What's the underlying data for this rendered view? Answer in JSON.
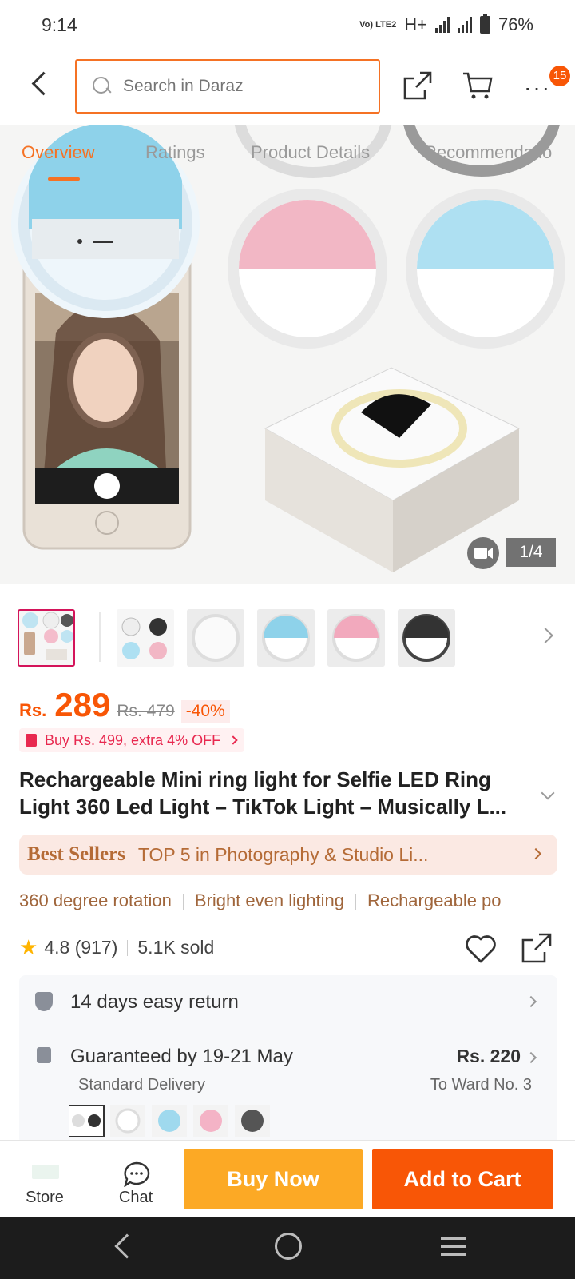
{
  "status_bar": {
    "time": "9:14",
    "network_label": "Vo) LTE2",
    "network_type": "H+",
    "battery": "76%"
  },
  "header": {
    "search_placeholder": "Search in Daraz",
    "cart_badge": "15"
  },
  "gallery_tabs": [
    "Overview",
    "Ratings",
    "Product Details",
    "Recommendatio"
  ],
  "active_tab": 0,
  "image_counter": "1/4",
  "thumbnail_count": 6,
  "price": {
    "currency": "Rs.",
    "current": "289",
    "original": "Rs. 479",
    "discount": "-40%"
  },
  "promo": {
    "text": "Buy Rs. 499, extra 4% OFF"
  },
  "product_title": "Rechargeable Mini ring light for Selfie LED Ring Light 360 Led Light – TikTok Light – Musically L...",
  "best_sellers": {
    "tag": "Best Sellers",
    "text": "TOP 5 in Photography & Studio Li..."
  },
  "features": [
    "360 degree rotation",
    "Bright even lighting",
    "Rechargeable po"
  ],
  "rating": {
    "score": "4.8",
    "count": "(917)",
    "sold": "5.1K sold"
  },
  "info": {
    "return_text": "14 days easy return",
    "delivery_text": "Guaranteed by 19-21 May",
    "delivery_sub": "Standard Delivery",
    "delivery_price": "Rs. 220",
    "delivery_location": "To Ward No. 3"
  },
  "bottom": {
    "store": "Store",
    "chat": "Chat",
    "buy_now": "Buy Now",
    "add_to_cart": "Add to Cart"
  },
  "colors": {
    "accent": "#f57224",
    "price": "#f85606",
    "buy_now": "#fca925",
    "add_to_cart": "#f85606",
    "best_seller": "#b56b36"
  }
}
